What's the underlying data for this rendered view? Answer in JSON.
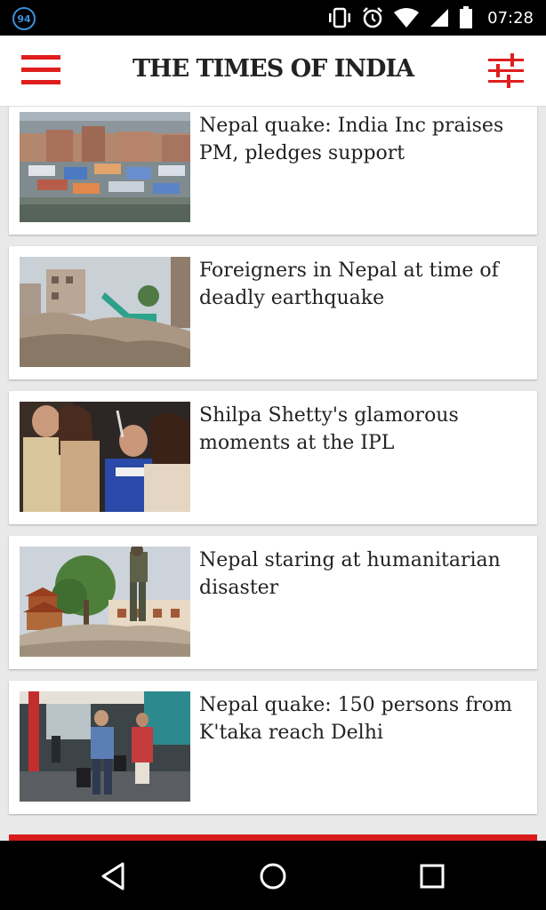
{
  "status_bar": {
    "notification_badge": "94",
    "time": "07:28"
  },
  "app": {
    "title": "THE TIMES OF INDIA",
    "brand_color": "#e01e1e"
  },
  "articles": [
    {
      "headline": "Nepal quake: India Inc praises PM, pledges support",
      "thumb": "tent-camp-photo"
    },
    {
      "headline": "Foreigners in Nepal at time of deadly earthquake",
      "thumb": "rubble-excavator-photo"
    },
    {
      "headline": "Shilpa Shetty's glamorous moments at the IPL",
      "thumb": "celebration-photo"
    },
    {
      "headline": "Nepal staring at humanitarian disaster",
      "thumb": "soldier-temples-photo"
    },
    {
      "headline": "Nepal quake: 150 persons from K'taka reach Delhi",
      "thumb": "airport-arrivals-photo"
    }
  ]
}
